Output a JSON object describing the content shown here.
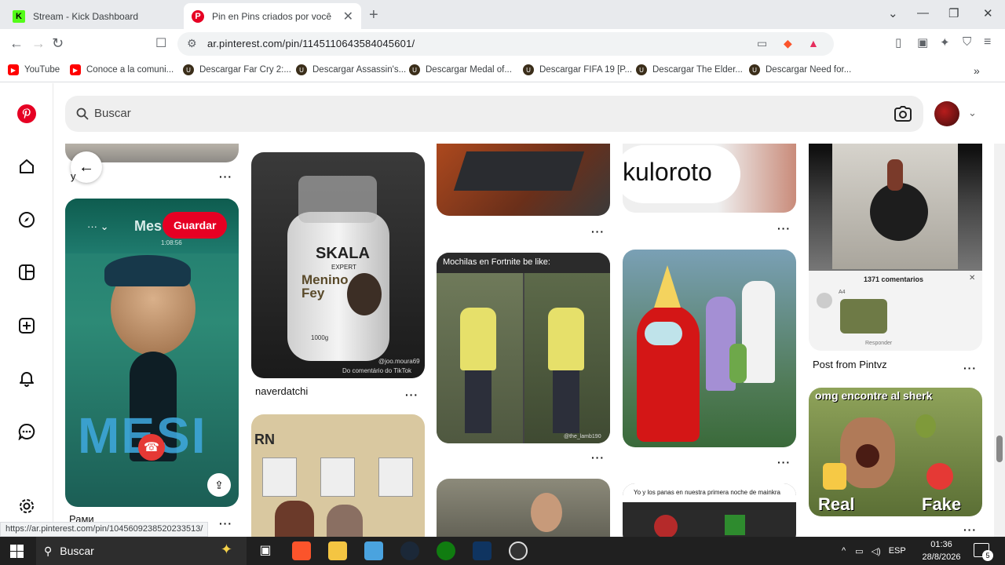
{
  "browser": {
    "tabs": [
      {
        "label": "Stream - Kick Dashboard",
        "active": false
      },
      {
        "label": "Pin en Pins criados por você",
        "active": true
      }
    ],
    "url": "ar.pinterest.com/pin/1145110643584045601/",
    "bookmarks": [
      "YouTube",
      "Conoce a la comuni...",
      "Descargar Far Cry 2:...",
      "Descargar Assassin's...",
      "Descargar Medal of...",
      "Descargar FIFA 19 [P...",
      "Descargar The Elder...",
      "Descargar Need for..."
    ],
    "status_url": "https://ar.pinterest.com/pin/1045609238520233513/"
  },
  "pinterest": {
    "search_placeholder": "Buscar",
    "save_label": "Guardar",
    "call_screen_name": "Mes",
    "call_timer": "1:08:56",
    "pin_titles": {
      "col1_partial": "y",
      "col1_bottom": "Рами",
      "col2": "naverdatchi",
      "col5": "Post from Pintvz"
    },
    "image_texts": {
      "skala_brand": "SKALA",
      "skala_sub": "EXPERT",
      "skala_product": "Menino Fey",
      "skala_weight": "1000g",
      "skala_credit1": "@joo.moura69",
      "skala_credit2": "Do comentário do TikTok",
      "kuloroto": "kuloroto",
      "mochilas": "Mochilas en Fortnite be like:",
      "mochilas_credit": "@the_lamb190",
      "comments_count": "1371 comentarios",
      "comment_user": "A4",
      "comment_reply": "Responder",
      "shrek_caption": "omg encontre al sherk",
      "shrek_real": "Real",
      "shrek_fake": "Fake",
      "mainkra": "Yo y los panas en nuestra primera noche de mainkra",
      "messi": "MESI",
      "rn": "RN"
    }
  },
  "taskbar": {
    "search_label": "Buscar",
    "lang": "ESP",
    "time": "01:36",
    "date": "28/8/2026",
    "notification_count": "5"
  },
  "colors": {
    "pinterest_red": "#e60023",
    "kick_green": "#53fc18",
    "youtube_red": "#ff0000"
  }
}
